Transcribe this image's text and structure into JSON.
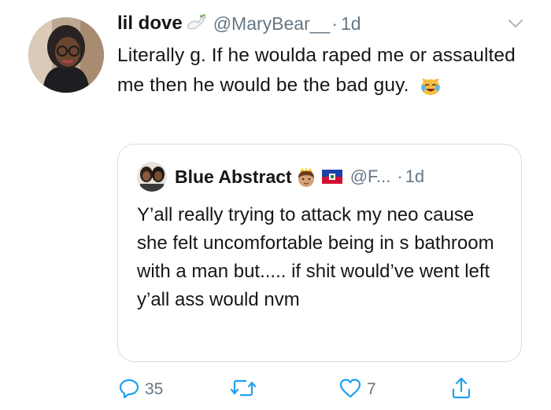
{
  "tweet": {
    "display_name": "lil dove",
    "handle": "@MaryBear__",
    "separator": "·",
    "time": "1d",
    "text": "Literally g. If he woulda raped me or assaulted me then he would be the bad guy.",
    "emoji": "😹"
  },
  "quoted_tweet": {
    "display_name": "Blue Abstract",
    "handle": "@F...",
    "separator": "·",
    "time": "1d",
    "text": "Y’all really trying to attack my neo cause she felt uncomfortable being in s bathroom with a man but..... if shit would’ve went left y’all ass would nvm"
  },
  "actions": {
    "reply_count": "35",
    "retweet_count": "",
    "like_count": "7"
  },
  "colors": {
    "text": "#14171a",
    "secondary": "#657786",
    "icon": "#1da1f2",
    "border": "#d6dde3"
  }
}
